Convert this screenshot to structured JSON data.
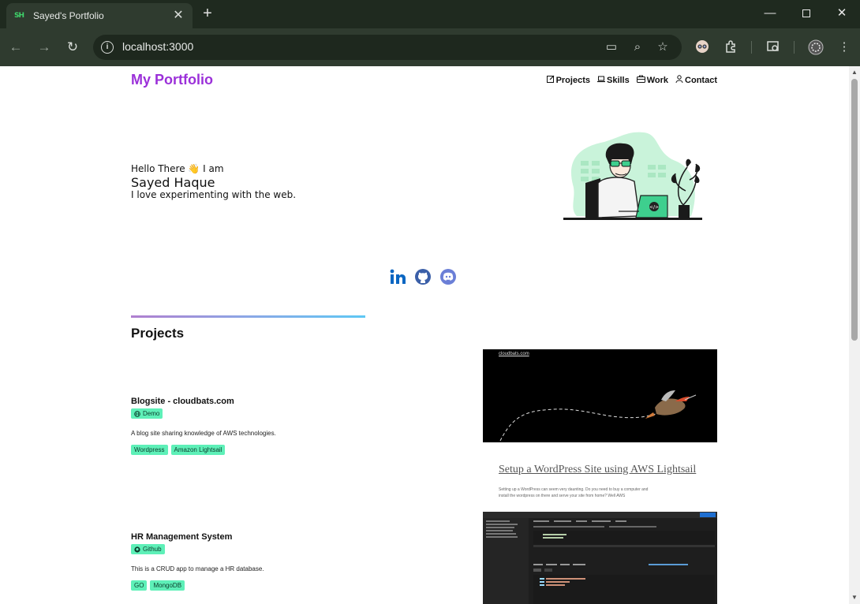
{
  "browser": {
    "tab_title": "Sayed's Portfolio",
    "favicon_text": "SH",
    "url": "localhost:3000"
  },
  "site": {
    "brand": "My Portfolio",
    "nav": [
      {
        "label": "Projects",
        "icon": "edit-icon"
      },
      {
        "label": "Skills",
        "icon": "laptop-icon"
      },
      {
        "label": "Work",
        "icon": "briefcase-icon"
      },
      {
        "label": "Contact",
        "icon": "person-icon"
      }
    ]
  },
  "hero": {
    "greeting": "Hello There 👋 I am",
    "name": "Sayed Haque",
    "tagline": "I love experimenting with the web."
  },
  "socials": [
    {
      "icon": "linkedin-icon",
      "color": "#0a66c2"
    },
    {
      "icon": "github-icon",
      "color": "#3b5fa8"
    },
    {
      "icon": "discord-icon",
      "color": "#6b7fd7"
    }
  ],
  "projects_section": {
    "title": "Projects",
    "items": [
      {
        "title": "Blogsite - cloudbats.com",
        "link_label": "Demo",
        "link_icon": "globe-icon",
        "description": "A blog site sharing knowledge of AWS technologies.",
        "tags": [
          "Wordpress",
          "Amazon Lightsail"
        ],
        "preview": {
          "site_name": "cloudbats.com",
          "headline": "Setup a WordPress Site using AWS Lightsail",
          "excerpt": "Setting up a WordPress can seem very daunting. Do you need to buy a computer and install the wordpress on there and serve your site from home? Well AWS"
        }
      },
      {
        "title": "HR Management System",
        "link_label": "Github",
        "link_icon": "github-icon",
        "description": "This is a CRUD app to manage a HR database.",
        "tags": [
          "GO",
          "MongoDB"
        ]
      }
    ]
  },
  "colors": {
    "brand": "#9b30d9",
    "chip": "#5ef0b8",
    "chrome_bg": "#2f3b2f"
  }
}
